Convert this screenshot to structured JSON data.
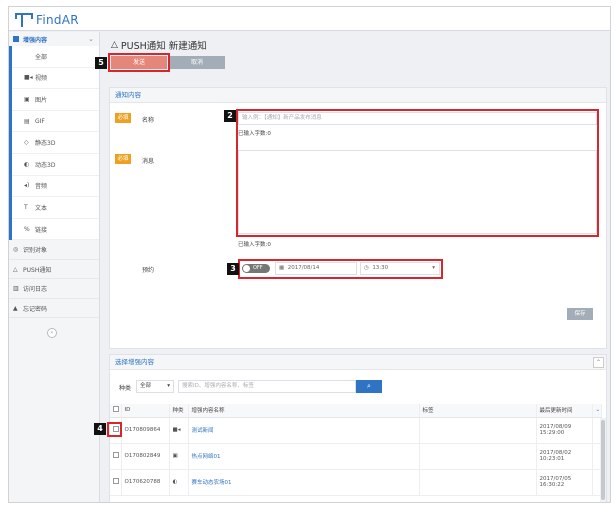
{
  "app": {
    "logo_text": "FindAR"
  },
  "sidebar": {
    "section_label": "增强内容",
    "sub_items": [
      {
        "label": "全部",
        "icon": "none"
      },
      {
        "label": "视频",
        "icon": "video-icon"
      },
      {
        "label": "图片",
        "icon": "image-icon"
      },
      {
        "label": "GIF",
        "icon": "gif-icon"
      },
      {
        "label": "静态3D",
        "icon": "cube-icon"
      },
      {
        "label": "动态3D",
        "icon": "spin-3d-icon"
      },
      {
        "label": "音频",
        "icon": "audio-icon"
      },
      {
        "label": "文本",
        "icon": "text-icon"
      },
      {
        "label": "链接",
        "icon": "link-icon"
      }
    ],
    "main_items": [
      {
        "label": "识别对象",
        "icon": "target-icon"
      },
      {
        "label": "PUSH通知",
        "icon": "bell-icon"
      },
      {
        "label": "访问日志",
        "icon": "chart-icon"
      },
      {
        "label": "忘记密码",
        "icon": "lock-icon"
      }
    ]
  },
  "page": {
    "title": "PUSH通知 新建通知"
  },
  "actions": {
    "send_label": "发送",
    "cancel_label": "取消"
  },
  "form": {
    "section_title": "通知内容",
    "required_label": "必填",
    "name_label": "名称",
    "name_placeholder": "输入例：【通知】新产品发布消息",
    "name_count": "已输入字数:0",
    "message_label": "消息",
    "message_count": "已输入字数:0",
    "schedule_label": "预约",
    "toggle_state": "OFF",
    "date_value": "2017/08/14",
    "time_value": "13:30",
    "save_label": "保存"
  },
  "select": {
    "section_title": "选择增强内容",
    "type_label": "种类",
    "type_value": "全部",
    "search_placeholder": "搜索ID、增强内容名称、标签",
    "columns": [
      "ID",
      "种类",
      "增强内容名称",
      "标签",
      "最后更新时间"
    ],
    "rows": [
      {
        "id": "O170809864",
        "type_icon": "video-icon",
        "name": "测试新闻",
        "tag": "",
        "date": "2017/08/09",
        "time": "15:29:00"
      },
      {
        "id": "O170802849",
        "type_icon": "image-icon",
        "name": "热点网络01",
        "tag": "",
        "date": "2017/08/02",
        "time": "10:23:01"
      },
      {
        "id": "O170620788",
        "type_icon": "spin-3d-icon",
        "name": "赛车动态农场01",
        "tag": "",
        "date": "2017/07/05",
        "time": "16:30:22"
      }
    ]
  },
  "annotations": [
    "2",
    "3",
    "4",
    "5"
  ],
  "colors": {
    "accent": "#2f73c4",
    "highlight": "#d8262f",
    "send": "#e5867a",
    "required": "#f0a020"
  }
}
